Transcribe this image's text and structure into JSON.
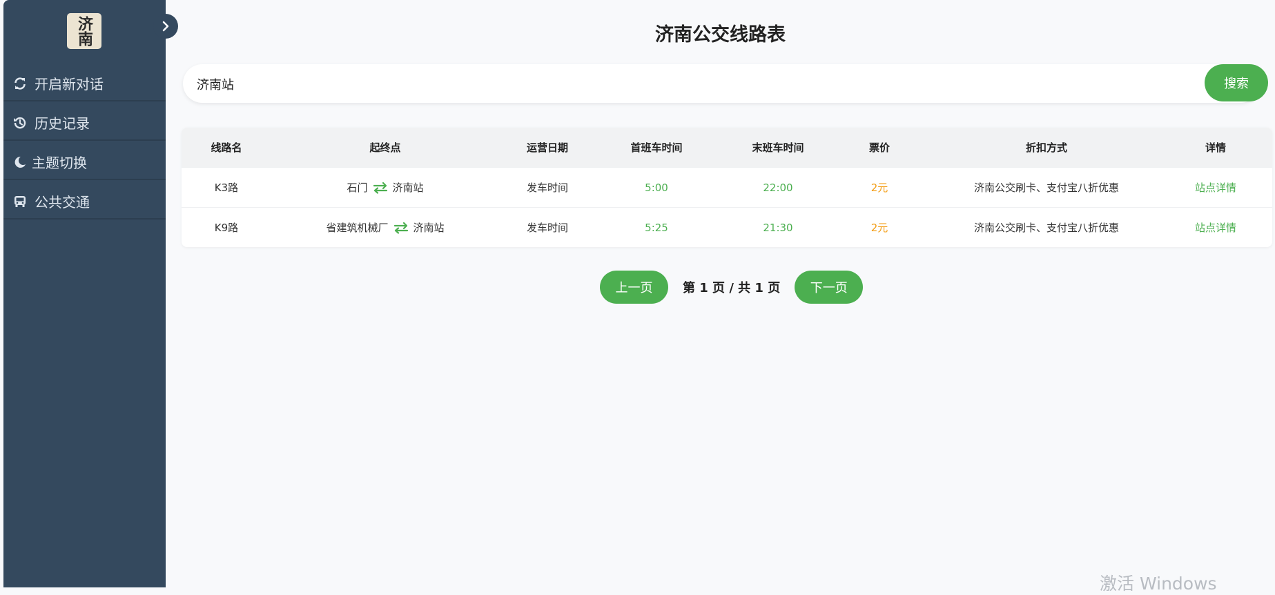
{
  "sidebar": {
    "logo_text": "济南",
    "items": [
      {
        "label": "开启新对话",
        "icon": "refresh-icon"
      },
      {
        "label": "历史记录",
        "icon": "history-icon"
      },
      {
        "label": "主题切换",
        "icon": "moon-icon"
      },
      {
        "label": "公共交通",
        "icon": "bus-icon"
      }
    ]
  },
  "page": {
    "title": "济南公交线路表"
  },
  "search": {
    "value": "济南站",
    "button_label": "搜索"
  },
  "table": {
    "headers": [
      "线路名",
      "起终点",
      "运营日期",
      "首班车时间",
      "末班车时间",
      "票价",
      "折扣方式",
      "详情"
    ],
    "rows": [
      {
        "name": "K3路",
        "start": "石门",
        "end": "济南站",
        "date": "发车时间",
        "first": "5:00",
        "last": "22:00",
        "price": "2元",
        "discount": "济南公交刷卡、支付宝八折优惠",
        "detail": "站点详情"
      },
      {
        "name": "K9路",
        "start": "省建筑机械厂",
        "end": "济南站",
        "date": "发车时间",
        "first": "5:25",
        "last": "21:30",
        "price": "2元",
        "discount": "济南公交刷卡、支付宝八折优惠",
        "detail": "站点详情"
      }
    ]
  },
  "pagination": {
    "prev_label": "上一页",
    "info": "第 1 页 / 共 1 页",
    "next_label": "下一页"
  },
  "watermark": "激活 Windows",
  "colors": {
    "sidebar": "#34495e",
    "accent": "#4caf50",
    "price": "#f39c12"
  }
}
